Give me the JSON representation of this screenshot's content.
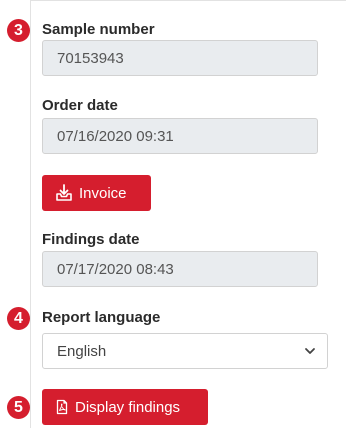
{
  "badges": {
    "sample": "3",
    "language": "4",
    "display": "5"
  },
  "sample": {
    "label": "Sample number",
    "value": "70153943"
  },
  "order": {
    "label": "Order date",
    "value": "07/16/2020 09:31"
  },
  "invoice": {
    "label": "Invoice",
    "icon": "download-tray-icon"
  },
  "findings": {
    "label": "Findings date",
    "value": "07/17/2020 08:43"
  },
  "language": {
    "label": "Report language",
    "selected": "English",
    "icon": "chevron-down-icon"
  },
  "display": {
    "label": "Display findings",
    "icon": "pdf-file-icon"
  },
  "colors": {
    "accent": "#d51e2e",
    "readonly_bg": "#e9ecef"
  }
}
